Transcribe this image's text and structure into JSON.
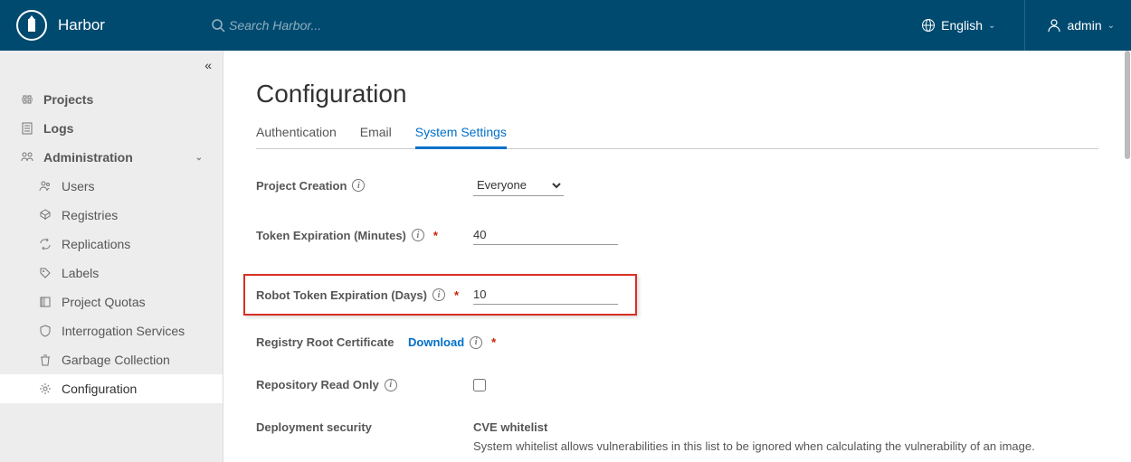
{
  "brand": "Harbor",
  "search": {
    "placeholder": "Search Harbor..."
  },
  "lang": "English",
  "user": "admin",
  "nav": {
    "projects": "Projects",
    "logs": "Logs",
    "administration": "Administration",
    "users": "Users",
    "registries": "Registries",
    "replications": "Replications",
    "labels": "Labels",
    "project_quotas": "Project Quotas",
    "interrogation": "Interrogation Services",
    "garbage": "Garbage Collection",
    "configuration": "Configuration"
  },
  "page": {
    "title": "Configuration",
    "tabs": {
      "auth": "Authentication",
      "email": "Email",
      "system": "System Settings"
    }
  },
  "form": {
    "project_creation": {
      "label": "Project Creation",
      "value": "Everyone"
    },
    "token_exp": {
      "label": "Token Expiration (Minutes)",
      "value": "40"
    },
    "robot_token": {
      "label": "Robot Token Expiration (Days)",
      "value": "10"
    },
    "root_cert": {
      "label": "Registry Root Certificate",
      "download": "Download"
    },
    "read_only": {
      "label": "Repository Read Only"
    },
    "deploy_sec": {
      "label": "Deployment security",
      "value": "CVE whitelist",
      "help": "System whitelist allows vulnerabilities in this list to be ignored when calculating the vulnerability of an image."
    }
  }
}
